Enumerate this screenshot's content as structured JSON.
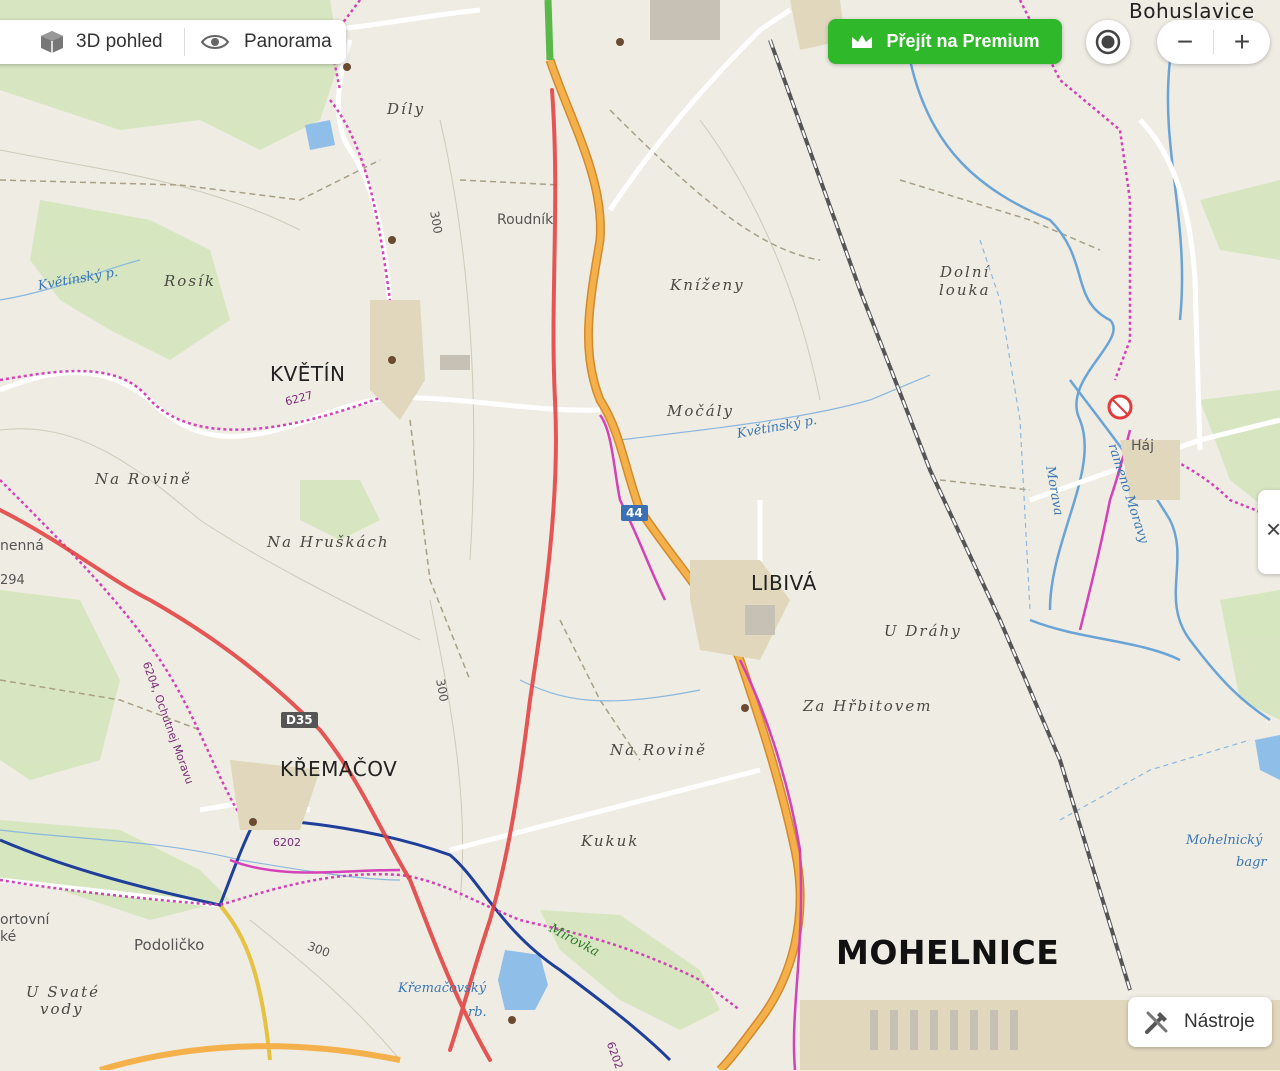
{
  "toolbar": {
    "view3d_label": "3D pohled",
    "panorama_label": "Panorama",
    "premium_label": "Přejít na Premium",
    "zoom_out_label": "−",
    "zoom_in_label": "+",
    "tools_label": "Nástroje",
    "side_toggle_label": "×"
  },
  "places": {
    "towns": [
      "KVĚTÍN",
      "LIBIVÁ",
      "KŘEMAČOV",
      "MOHELNICE"
    ],
    "villages": [
      "Bohuslavice",
      "Roudník",
      "Podoličko",
      "Háj",
      "ortovní",
      "ké",
      "nenná"
    ],
    "localities": [
      "Díly",
      "Rosík",
      "Kníženy",
      "Močály",
      "Dolní",
      "louka",
      "Na Rovině",
      "Na Hruškách",
      "U Dráhy",
      "Za Hřbitovem",
      "Na Rovině",
      "Kukuk",
      "U Svaté",
      "vody"
    ],
    "water": [
      "Květínský p.",
      "Květínský p.",
      "Morava",
      "rameno Moravy",
      "Mírovka",
      "Křemačovský",
      "rb.",
      "Mohelnický",
      "bagr"
    ],
    "elevation": [
      "294",
      "300",
      "300",
      "300"
    ]
  },
  "roads": {
    "shields": [
      "44",
      "D35"
    ],
    "route_numbers": [
      "6227",
      "6202",
      "6202",
      "6204, Ochutnej Moravu"
    ]
  },
  "colors": {
    "land": "#eeece3",
    "forest": "#cfe3b8",
    "water": "#6aa3d6",
    "highway": "#f4b04b",
    "motorway_planned": "#e23b3b",
    "cycle_route": "#d441b8",
    "premium": "#2fb82a"
  },
  "icons": [
    "cube-icon",
    "eye-icon",
    "crown-icon",
    "locate-icon",
    "tools-icon",
    "close-icon"
  ]
}
